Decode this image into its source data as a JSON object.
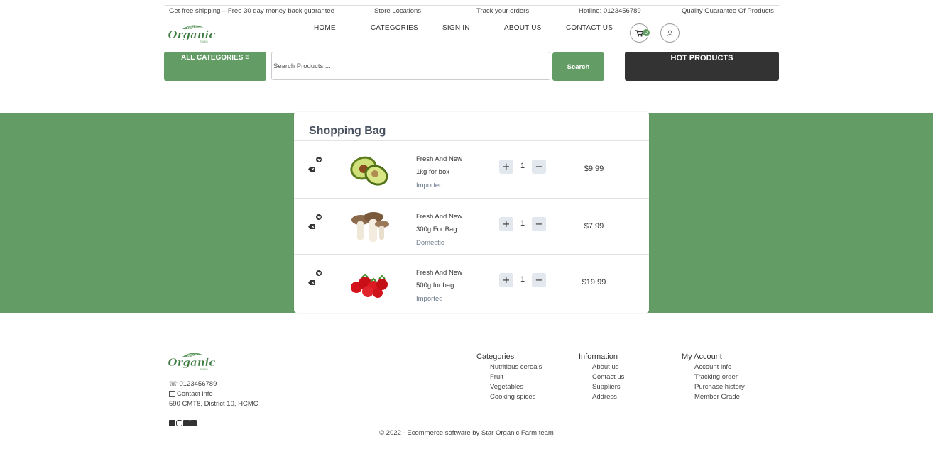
{
  "topbar": {
    "shipping": "Get free shipping – Free 30 day money back guarantee",
    "stores": "Store Locations",
    "track": "Track your orders",
    "hotline": "Hotline: 0123456789",
    "quality": "Quality Guarantee Of Products"
  },
  "logo": {
    "star": "STAR",
    "name": "Organic",
    "farm": "FARM"
  },
  "nav": {
    "home": "HOME",
    "categories": "CATEGORIES",
    "signin": "SIGN IN",
    "about": "ABOUT US",
    "contact": "CONTACT US"
  },
  "cart": {
    "count": "0"
  },
  "search": {
    "all_categories": "ALL CATEGORIES",
    "placeholder": "Search Products....",
    "button": "Search",
    "hot_products": "HOT PRODUCTS"
  },
  "bag": {
    "title": "Shopping Bag",
    "items": [
      {
        "name": "Fresh And New",
        "size": "1kg for box",
        "origin": "Imported",
        "qty": "1",
        "price": "$9.99",
        "product": "avocado"
      },
      {
        "name": "Fresh And New",
        "size": "300g For Bag",
        "origin": "Domestic",
        "qty": "1",
        "price": "$7.99",
        "product": "mushroom"
      },
      {
        "name": "Fresh And New",
        "size": "500g for bag",
        "origin": "Imported",
        "qty": "1",
        "price": "$19.99",
        "product": "strawberry"
      }
    ]
  },
  "footer": {
    "phone": "☏ 0123456789",
    "contact_info": "Contact info",
    "address": "590 CMT8, District 10, HCMC",
    "columns": [
      {
        "title": "Categories",
        "items": [
          "Nutritious cereals",
          "Fruit",
          "Vegetables",
          "Cooking spices"
        ]
      },
      {
        "title": "Information",
        "items": [
          "About us",
          "Contact us",
          "Suppliers",
          "Address"
        ]
      },
      {
        "title": "My Account",
        "items": [
          "Account info",
          "Tracking order",
          "Purchase history",
          "Member Grade"
        ]
      }
    ],
    "copyright": "© 2022 - Ecommerce software by Star Organic Farm team"
  },
  "colors": {
    "brand_green": "#639c64",
    "dark": "#333333",
    "qty_button": "#e2e8ee"
  }
}
